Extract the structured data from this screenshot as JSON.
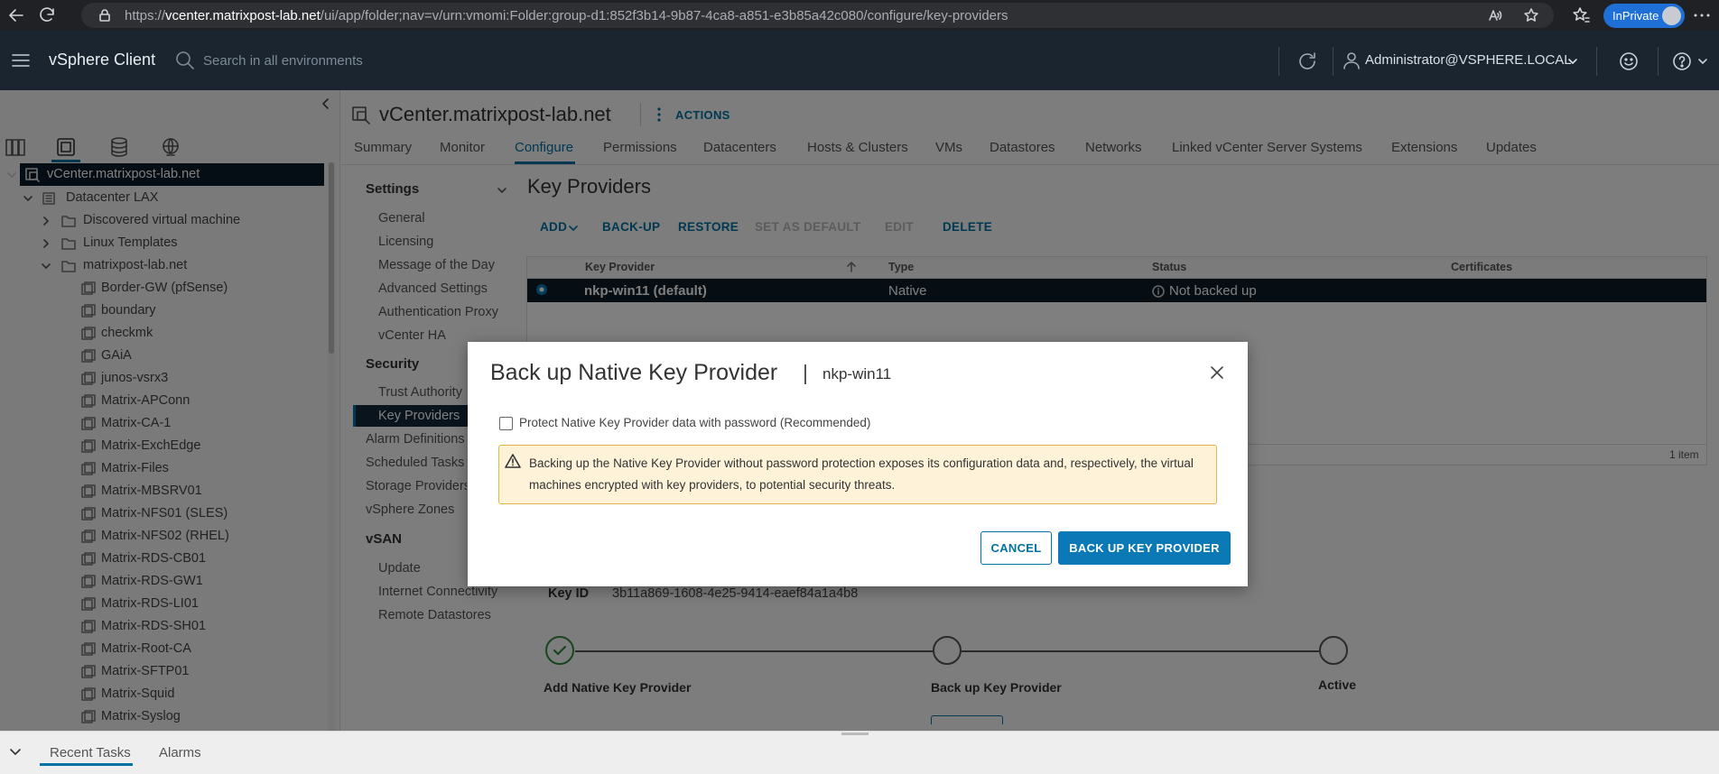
{
  "browser": {
    "url_prefix": "https://",
    "url_host": "vcenter.matrixpost-lab.net",
    "url_path": "/ui/app/folder;nav=v/urn:vmomi:Folder:group-d1:852f3b14-9b87-4ca8-a851-e3b85a42c080/configure/key-providers",
    "inprivate_label": "InPrivate"
  },
  "header": {
    "app_title": "vSphere Client",
    "search_placeholder": "Search in all environments",
    "user": "Administrator@VSPHERE.LOCAL"
  },
  "tree": {
    "root": "vCenter.matrixpost-lab.net",
    "datacenter": "Datacenter LAX",
    "folders": [
      "Discovered virtual machine",
      "Linux Templates",
      "matrixpost-lab.net"
    ],
    "vms": [
      "Border-GW (pfSense)",
      "boundary",
      "checkmk",
      "GAiA",
      "junos-vsrx3",
      "Matrix-APConn",
      "Matrix-CA-1",
      "Matrix-ExchEdge",
      "Matrix-Files",
      "Matrix-MBSRV01",
      "Matrix-NFS01 (SLES)",
      "Matrix-NFS02 (RHEL)",
      "Matrix-RDS-CB01",
      "Matrix-RDS-GW1",
      "Matrix-RDS-LI01",
      "Matrix-RDS-SH01",
      "Matrix-Root-CA",
      "Matrix-SFTP01",
      "Matrix-Squid",
      "Matrix-Syslog"
    ]
  },
  "object": {
    "title": "vCenter.matrixpost-lab.net",
    "actions_label": "ACTIONS",
    "tabs": [
      "Summary",
      "Monitor",
      "Configure",
      "Permissions",
      "Datacenters",
      "Hosts & Clusters",
      "VMs",
      "Datastores",
      "Networks",
      "Linked vCenter Server Systems",
      "Extensions",
      "Updates"
    ]
  },
  "config_nav": {
    "settings_header": "Settings",
    "settings_items": [
      "General",
      "Licensing",
      "Message of the Day",
      "Advanced Settings",
      "Authentication Proxy",
      "vCenter HA"
    ],
    "security_header": "Security",
    "security_items": [
      "Trust Authority",
      "Key Providers"
    ],
    "other_items": [
      "Alarm Definitions",
      "Scheduled Tasks",
      "Storage Providers",
      "vSphere Zones"
    ],
    "vsan_header": "vSAN",
    "vsan_items": [
      "Update",
      "Internet Connectivity",
      "Remote Datastores"
    ]
  },
  "key_providers": {
    "title": "Key Providers",
    "toolbar": {
      "add": "ADD",
      "backup": "BACK-UP",
      "restore": "RESTORE",
      "set_default": "SET AS DEFAULT",
      "edit": "EDIT",
      "delete": "DELETE"
    },
    "columns": [
      "Key Provider",
      "Type",
      "Status",
      "Certificates"
    ],
    "row": {
      "name": "nkp-win11 (default)",
      "type": "Native",
      "status": "Not backed up"
    },
    "footer_count": "1 item",
    "key_id_label": "Key ID",
    "key_id_value": "3b11a869-1608-4e25-9414-eaef84a1a4b8",
    "steps": [
      "Add Native Key Provider",
      "Back up Key Provider",
      "Active"
    ]
  },
  "modal": {
    "title": "Back up Native Key Provider",
    "subtitle": "nkp-win11",
    "checkbox_label": "Protect Native Key Provider data with password (Recommended)",
    "checkbox_checked": false,
    "warning": "Backing up the Native Key Provider without password protection exposes its configuration data and, respectively, the virtual machines encrypted with key providers, to potential security threats.",
    "cancel_label": "CANCEL",
    "confirm_label": "BACK UP KEY PROVIDER"
  },
  "bottom": {
    "tabs": [
      "Recent Tasks",
      "Alarms"
    ]
  },
  "colors": {
    "accent": "#0072a3",
    "header_bg": "#1a2530",
    "selection": "#0c1c29",
    "warning_bg": "#fef3d9"
  }
}
